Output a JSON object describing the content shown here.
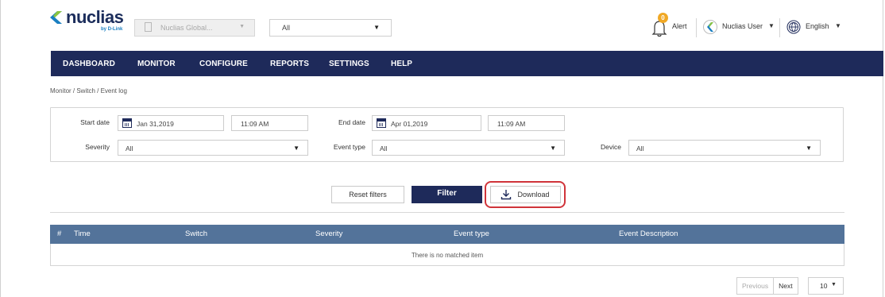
{
  "brand": {
    "name": "nuclias",
    "sub": "by D-Link",
    "accent": "#1e2a5a",
    "logo_blue": "#1a7fc1",
    "logo_navy": "#1b2d5b"
  },
  "header": {
    "org_select": {
      "value": "Nuclias Global...",
      "icon": "building-icon"
    },
    "site_select": {
      "value": "All"
    },
    "alert": {
      "label": "Alert",
      "count": "0",
      "icon": "bell-icon"
    },
    "user": {
      "label": "Nuclias User",
      "icon": "nuclias-avatar-icon"
    },
    "language": {
      "label": "English",
      "icon": "globe-icon"
    }
  },
  "nav": {
    "items": [
      "DASHBOARD",
      "MONITOR",
      "CONFIGURE",
      "REPORTS",
      "SETTINGS",
      "HELP"
    ],
    "bg": "#1e2a5a"
  },
  "breadcrumb": "Monitor / Switch / Event log",
  "filters": {
    "start_date_label": "Start date",
    "start_date": "Jan 31,2019",
    "start_time": "11:09 AM",
    "end_date_label": "End date",
    "end_date": "Apr 01,2019",
    "end_time": "11:09 AM",
    "severity_label": "Severity",
    "severity_value": "All",
    "event_type_label": "Event type",
    "event_type_value": "All",
    "device_label": "Device",
    "device_value": "All"
  },
  "buttons": {
    "reset": "Reset filters",
    "filter": "Filter",
    "download": "Download",
    "highlight_color": "#d0343a"
  },
  "table": {
    "header_bg": "#53739a",
    "columns": [
      "#",
      "Time",
      "Switch",
      "Severity",
      "Event type",
      "Event Description"
    ],
    "empty_text": "There is no matched item"
  },
  "pagination": {
    "previous": "Previous",
    "next": "Next",
    "page_size": "10"
  }
}
